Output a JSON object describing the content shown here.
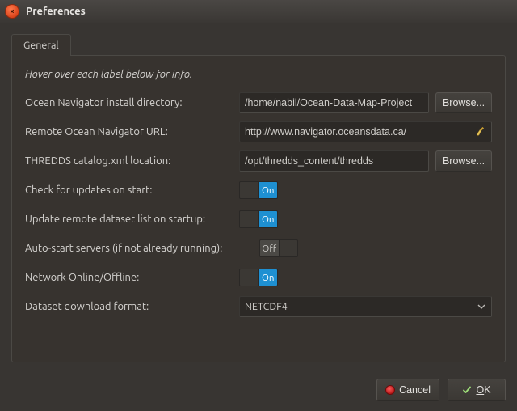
{
  "window": {
    "title": "Preferences"
  },
  "tabs": {
    "general": "General"
  },
  "hint": "Hover over each label below for info.",
  "labels": {
    "install_dir": "Ocean Navigator install directory:",
    "remote_url": "Remote Ocean Navigator URL:",
    "thredds": "THREDDS catalog.xml location:",
    "check_updates": "Check for updates on start:",
    "update_remote": "Update remote dataset list on startup:",
    "auto_start": "Auto-start servers (if not already running):",
    "network": "Network Online/Offline:",
    "download_format": "Dataset download format:"
  },
  "values": {
    "install_dir": "/home/nabil/Ocean-Data-Map-Project",
    "remote_url": "http://www.navigator.oceansdata.ca/",
    "thredds": "/opt/thredds_content/thredds",
    "download_format": "NETCDF4"
  },
  "toggles": {
    "on": "On",
    "off": "Off",
    "check_updates": "on",
    "update_remote": "on",
    "auto_start": "off",
    "network": "on"
  },
  "buttons": {
    "browse": "Browse...",
    "cancel": "Cancel",
    "ok": "OK",
    "ok_underline": "O"
  },
  "icons": {
    "clear": "broom-icon"
  }
}
